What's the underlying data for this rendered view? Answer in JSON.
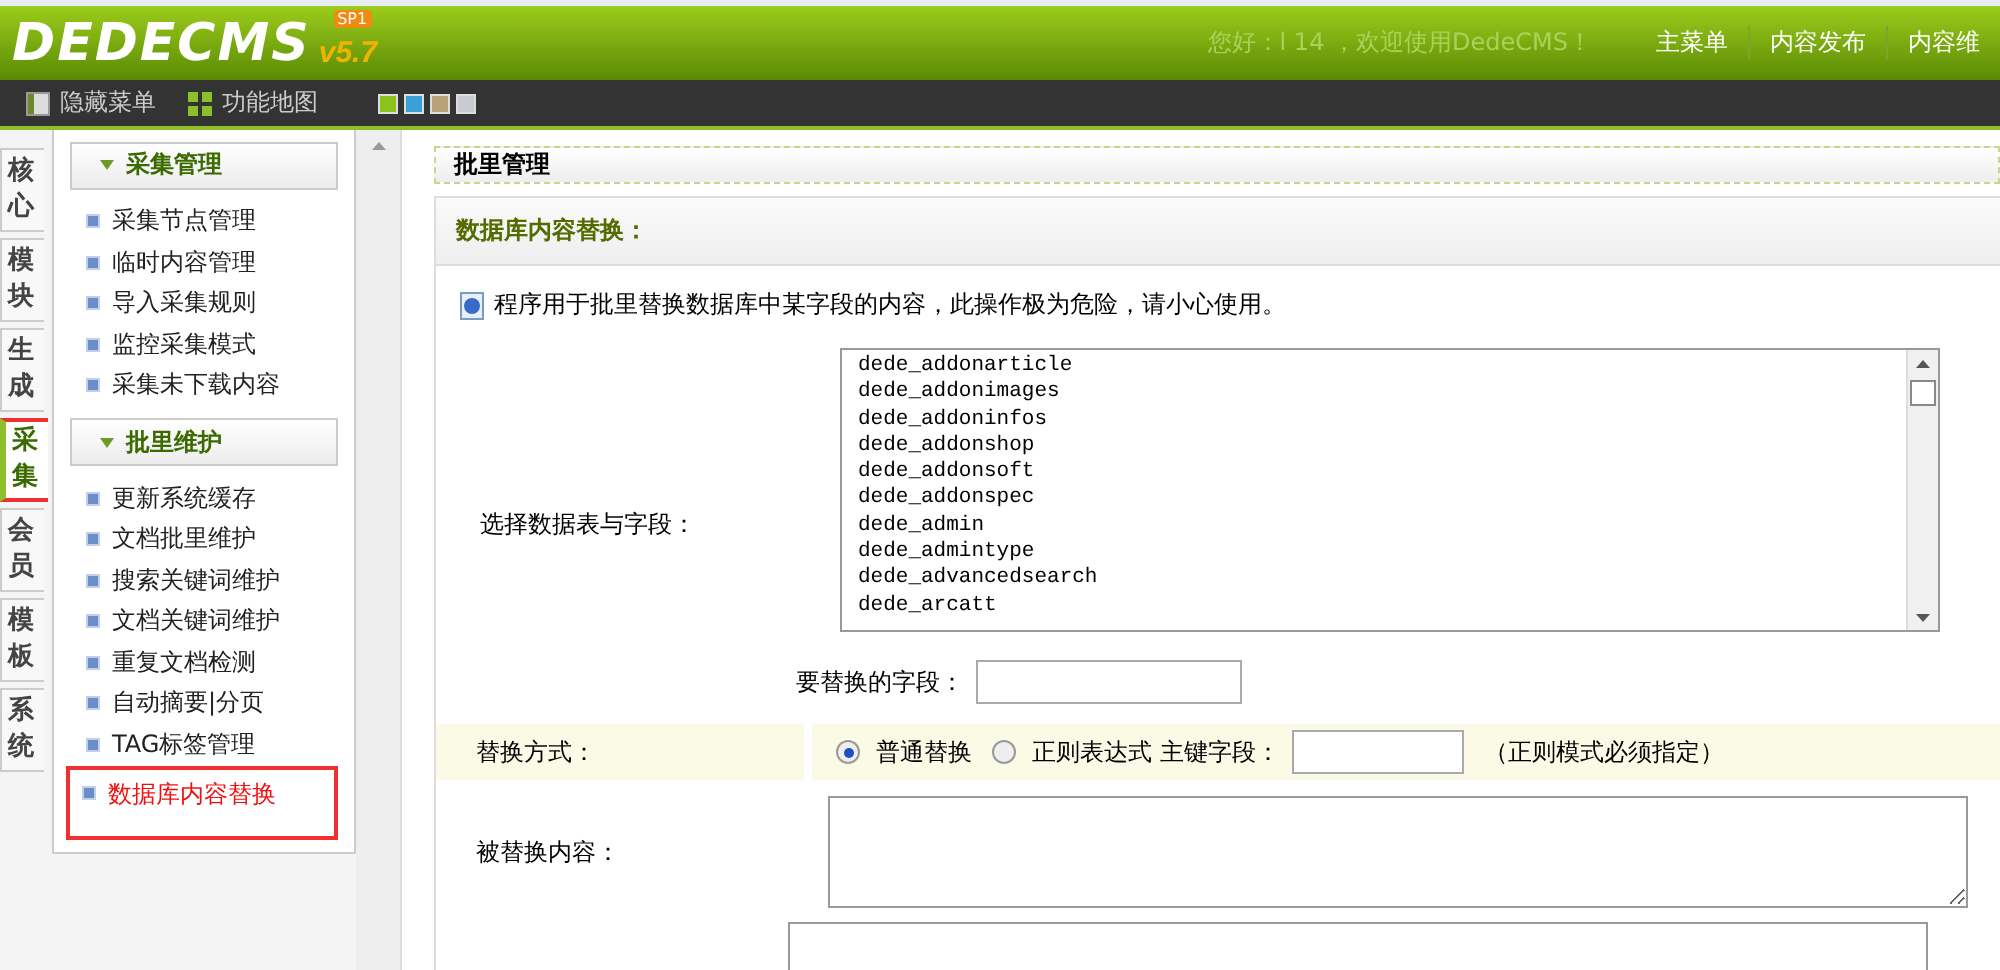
{
  "header": {
    "logo": "DEDECMS",
    "version": "v5.7",
    "badge": "SP1",
    "greeting": "您好：l   14 ，欢迎使用DedeCMS！",
    "nav": [
      {
        "label": "主菜单",
        "selected": false
      },
      {
        "label": "内容发布",
        "selected": false
      },
      {
        "label": "内容维",
        "selected": false
      }
    ]
  },
  "toolbar": {
    "buttons": [
      "隐藏菜单",
      "功能地图"
    ],
    "themes": [
      {
        "color": "#8cc21c"
      },
      {
        "color": "#3aa0d8"
      },
      {
        "color": "#b8a27a"
      },
      {
        "color": "#c8ccd0"
      }
    ]
  },
  "side_tabs": [
    {
      "label": "核心",
      "selected": false
    },
    {
      "label": "模块",
      "selected": false
    },
    {
      "label": "生成",
      "selected": false
    },
    {
      "label": "采集",
      "selected": true
    },
    {
      "label": "会员",
      "selected": false
    },
    {
      "label": "模板",
      "selected": false
    },
    {
      "label": "系统",
      "selected": false
    }
  ],
  "menu_groups": [
    {
      "title": "采集管理",
      "expanded": true,
      "items": [
        {
          "label": "采集节点管理",
          "selected": false
        },
        {
          "label": "临时内容管理",
          "selected": false
        },
        {
          "label": "导入采集规则",
          "selected": false
        },
        {
          "label": "监控采集模式",
          "selected": false
        },
        {
          "label": "采集未下载内容",
          "selected": false
        }
      ]
    },
    {
      "title": "批里维护",
      "expanded": true,
      "items": [
        {
          "label": "更新系统缓存",
          "selected": false
        },
        {
          "label": "文档批里维护",
          "selected": false
        },
        {
          "label": "搜索关键词维护",
          "selected": false
        },
        {
          "label": "文档关键词维护",
          "selected": false
        },
        {
          "label": "重复文档检测",
          "selected": false
        },
        {
          "label": "自动摘要|分页",
          "selected": false
        },
        {
          "label": "TAG标签管理",
          "selected": false
        },
        {
          "label": "数据库内容替换",
          "selected": true
        }
      ]
    }
  ],
  "main": {
    "panel_title": "批里管理",
    "section_title": "数据库内容替换：",
    "notice": "程序用于批里替换数据库中某字段的内容，此操作极为危险，请小心使用。",
    "table_select": {
      "label": "选择数据表与字段：",
      "options": [
        "dede_addonarticle",
        "dede_addonimages",
        "dede_addoninfos",
        "dede_addonshop",
        "dede_addonsoft",
        "dede_addonspec",
        "dede_admin",
        "dede_admintype",
        "dede_advancedsearch",
        "dede_arcatt"
      ]
    },
    "field_input": {
      "label": "要替换的字段："
    },
    "mode": {
      "label": "替换方式：",
      "options": [
        {
          "label": "普通替换",
          "selected": true
        },
        {
          "label": "正则表达式",
          "selected": false
        }
      ],
      "key_field_label": "主键字段：",
      "hint": "（正则模式必须指定）"
    },
    "replaced_content": {
      "label": "被替换内容："
    }
  }
}
